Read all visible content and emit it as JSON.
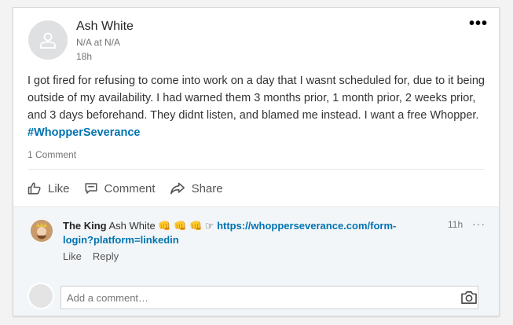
{
  "post": {
    "author": "Ash White",
    "headline": "N/A at N/A",
    "time": "18h",
    "text": "I got fired for refusing to come into work on a day that I wasnt scheduled for, due to it being outside of my availability. I had warned them 3 months prior, 1 month prior, 2 weeks prior, and 3 days beforehand. They didnt listen, and blamed me instead.  I want a free Whopper.",
    "hashtag": "#WhopperSeverance",
    "comment_count": "1 Comment",
    "more_icon": "•••"
  },
  "actions": {
    "like": "Like",
    "comment": "Comment",
    "share": "Share"
  },
  "comment": {
    "author": "The King",
    "mention": "Ash White",
    "emojis": "👊 👊 👊 ☞",
    "link": "https://whopperseverance.com/form-login?platform=linkedin",
    "time": "11h",
    "more_icon": "···",
    "like": "Like",
    "reply": "Reply"
  },
  "composer": {
    "placeholder": "Add a comment…"
  },
  "colors": {
    "link": "#0073b1",
    "background": "#f3f3f3",
    "comment_background": "#f3f6f8"
  }
}
